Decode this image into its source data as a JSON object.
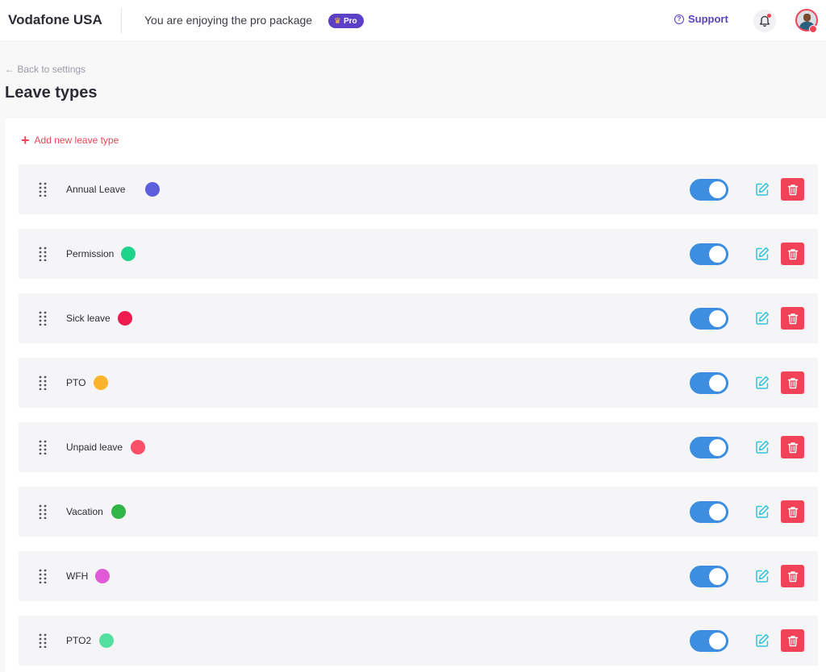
{
  "header": {
    "brand": "Vodafone USA",
    "package_text": "You are enjoying the pro package",
    "pro_badge": "Pro",
    "support_label": "Support",
    "bell_icon": "bell-icon",
    "avatar_icon": "user-avatar"
  },
  "page": {
    "back_link": "← Back to settings",
    "title": "Leave types"
  },
  "actions": {
    "add_label": "Add new leave type"
  },
  "colors": {
    "accent": "#f04358",
    "brand_purple": "#5b3fc4",
    "toggle_on": "#3d8ee0",
    "edit_icon": "#2ec4d9"
  },
  "leave_types": [
    {
      "label": "Annual Leave",
      "color": "#5b5fdb",
      "enabled": true
    },
    {
      "label": "Permission",
      "color": "#1dd48a",
      "enabled": true
    },
    {
      "label": "Sick leave",
      "color": "#ee1c4e",
      "enabled": true
    },
    {
      "label": "PTO",
      "color": "#fbb22c",
      "enabled": true
    },
    {
      "label": "Unpaid leave",
      "color": "#fb5068",
      "enabled": true
    },
    {
      "label": "Vacation",
      "color": "#2fb548",
      "enabled": true
    },
    {
      "label": "WFH",
      "color": "#e059d6",
      "enabled": true
    },
    {
      "label": "PTO2",
      "color": "#54e0a0",
      "enabled": true
    }
  ]
}
